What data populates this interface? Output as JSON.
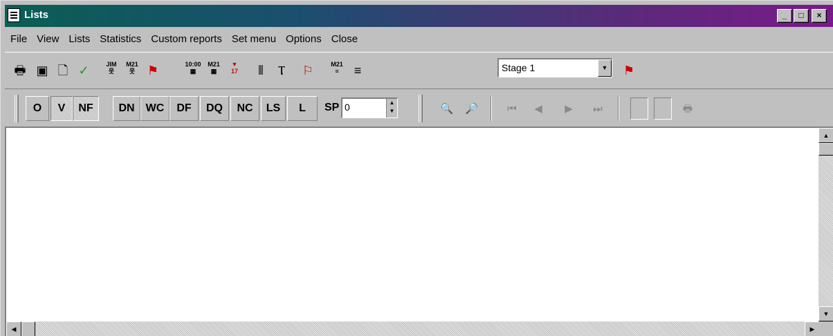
{
  "window": {
    "title": "Lists",
    "controls": {
      "minimize": "_",
      "maximize": "□",
      "close": "×"
    }
  },
  "menu": [
    "File",
    "View",
    "Lists",
    "Statistics",
    "Custom reports",
    "Set menu",
    "Options",
    "Close"
  ],
  "toolbar1": {
    "tools": [
      {
        "name": "print-icon",
        "glyph": "🖶"
      },
      {
        "name": "save-icon",
        "glyph": "💾"
      },
      {
        "name": "preview-icon",
        "glyph": "🔍"
      },
      {
        "name": "check-icon",
        "glyph": "✓"
      },
      {
        "name": "runner-jim-icon",
        "label": "JIM"
      },
      {
        "name": "runner-m21-icon",
        "label": "M21"
      },
      {
        "name": "runner-red-icon",
        "glyph": "⚑"
      },
      {
        "name": "time-1000-icon",
        "label": "10:00"
      },
      {
        "name": "calendar-m21-icon",
        "label": "M21"
      },
      {
        "name": "calendar-red-icon",
        "label": "17"
      },
      {
        "name": "medals-icon",
        "glyph": "⋯"
      },
      {
        "name": "trophy-icon",
        "glyph": "🏆"
      },
      {
        "name": "team-icon",
        "glyph": "⚐"
      },
      {
        "name": "list-m21-icon",
        "label": "M21"
      },
      {
        "name": "list-red-icon",
        "glyph": "≡"
      }
    ],
    "stage": {
      "value": "Stage 1"
    },
    "flag_tool": "flag-list-icon"
  },
  "toolbar2": {
    "codes": [
      "O",
      "V",
      "NF",
      "DN",
      "WC",
      "DF",
      "DQ",
      "NC",
      "LS",
      "L"
    ],
    "sp_label": "SP",
    "sp_value": "0"
  }
}
